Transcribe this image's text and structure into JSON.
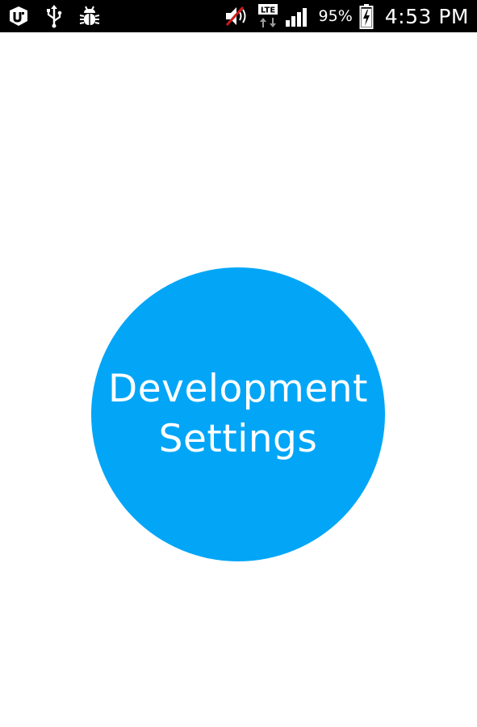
{
  "status_bar": {
    "left_icons": [
      "carrier-app-icon",
      "usb-icon",
      "debug-bug-icon"
    ],
    "right_icons": [
      "volume-muted-icon",
      "lte-data-icon",
      "signal-strength-icon"
    ],
    "network_label": "LTE",
    "battery_percent": "95%",
    "battery_level": 0.95,
    "charging": true,
    "time": "4:53 PM"
  },
  "main": {
    "button": {
      "line1": "Development",
      "line2": "Settings"
    }
  },
  "colors": {
    "status_bar_bg": "#000000",
    "status_icon": "#ffffff",
    "circle": "#03a6f7",
    "circle_text": "#ffffff",
    "background": "#ffffff",
    "mute_slash": "#d11a1a"
  }
}
